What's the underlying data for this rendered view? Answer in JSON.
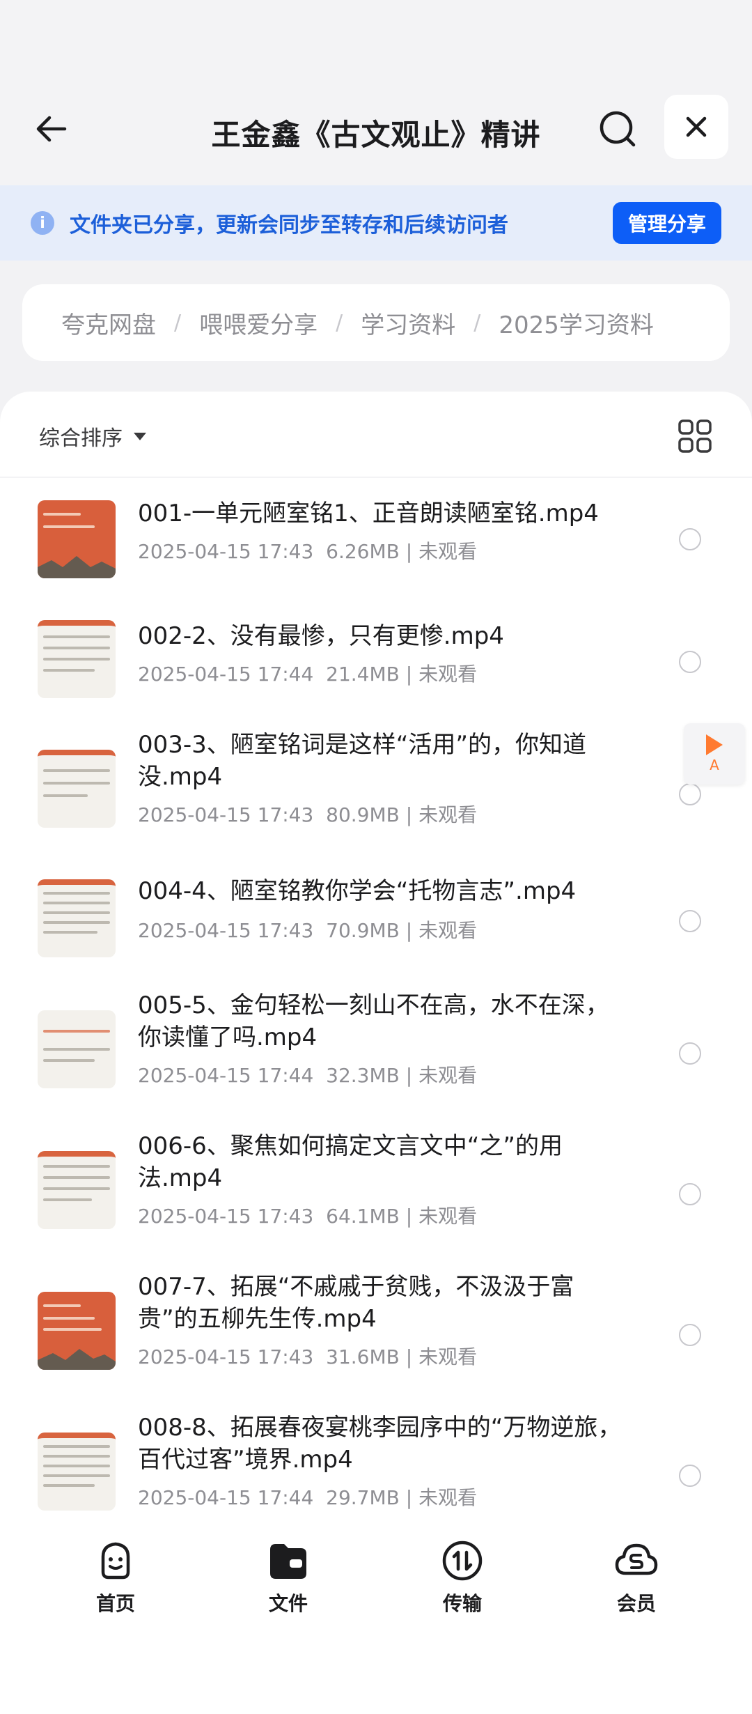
{
  "header": {
    "title": "王金鑫《古文观止》精讲"
  },
  "banner": {
    "info_icon": "i",
    "text": "文件夹已分享，更新会同步至转存和后续访问者",
    "manage_label": "管理分享",
    "accent": "#0d5ef7"
  },
  "breadcrumb": [
    "夸克网盘",
    "喂喂爱分享",
    "学习资料",
    "2025学习资料"
  ],
  "sort": {
    "label": "综合排序"
  },
  "files": [
    {
      "name": "001-一单元陋室铭1、正音朗读陋室铭.mp4",
      "date": "2025-04-15 17:43",
      "size": "6.26MB",
      "status": "未观看",
      "thumb": "orange"
    },
    {
      "name": "002-2、没有最惨，只有更惨.mp4",
      "date": "2025-04-15 17:44",
      "size": "21.4MB",
      "status": "未观看",
      "thumb": "paper"
    },
    {
      "name": "003-3、陋室铭词是这样“活用”的，你知道没.mp4",
      "date": "2025-04-15 17:43",
      "size": "80.9MB",
      "status": "未观看",
      "thumb": "paper"
    },
    {
      "name": "004-4、陋室铭教你学会“托物言志”.mp4",
      "date": "2025-04-15 17:43",
      "size": "70.9MB",
      "status": "未观看",
      "thumb": "paper"
    },
    {
      "name": "005-5、金句轻松一刻山不在高，水不在深，你读懂了吗.mp4",
      "date": "2025-04-15 17:44",
      "size": "32.3MB",
      "status": "未观看",
      "thumb": "paper"
    },
    {
      "name": "006-6、聚焦如何搞定文言文中“之”的用法.mp4",
      "date": "2025-04-15 17:43",
      "size": "64.1MB",
      "status": "未观看",
      "thumb": "paper"
    },
    {
      "name": "007-7、拓展“不戚戚于贫贱，不汲汲于富贵”的五柳先生传.mp4",
      "date": "2025-04-15 17:43",
      "size": "31.6MB",
      "status": "未观看",
      "thumb": "orange"
    },
    {
      "name": "008-8、拓展春夜宴桃李园序中的“万物逆旅，百代过客”境界.mp4",
      "date": "2025-04-15 17:44",
      "size": "29.7MB",
      "status": "未观看",
      "thumb": "paper"
    }
  ],
  "float_player": {
    "label": "A"
  },
  "nav": [
    {
      "label": "首页",
      "icon": "home-face-icon"
    },
    {
      "label": "文件",
      "icon": "folder-icon"
    },
    {
      "label": "传输",
      "icon": "transfer-icon"
    },
    {
      "label": "会员",
      "icon": "vip-cloud-icon"
    }
  ]
}
